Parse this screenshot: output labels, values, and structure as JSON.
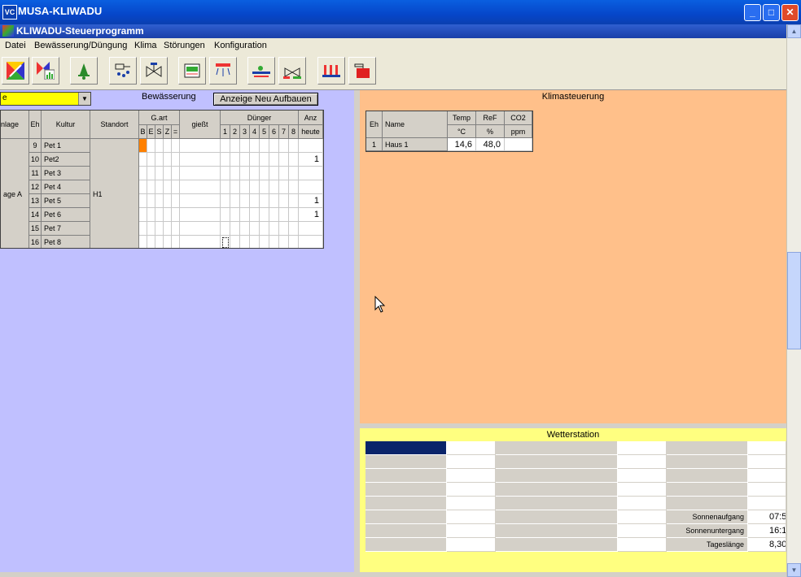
{
  "window": {
    "title": "MUSA-KLIWADU",
    "icon_text": "VC",
    "minimize": "_",
    "maximize": "□",
    "close": "✕"
  },
  "inner_window": {
    "title": "KLIWADU-Steuerprogramm"
  },
  "menu": [
    "Datei",
    "Bewässerung/Düngung",
    "Klima",
    "Störungen",
    "Konfiguration"
  ],
  "toolbar": [
    "wizard-icon",
    "chart-icon",
    "bell-icon",
    "fertilizer-icon",
    "valve-icon",
    "controller-icon",
    "sprinkler-icon",
    "pipeline-icon",
    "valve-station-icon",
    "heater-icon",
    "boiler-icon"
  ],
  "irrigation": {
    "select_value": "e",
    "title": "Bewässerung",
    "rebuild_button": "Anzeige Neu Aufbauen",
    "headers": {
      "anlage": "nlage",
      "eh": "Eh",
      "kultur": "Kultur",
      "standort": "Standort",
      "gart": "G.art",
      "gart_sub": [
        "B",
        "E",
        "S",
        "Z",
        "="
      ],
      "giesst": "gießt",
      "duenger": "Dünger",
      "duenger_sub": [
        "1",
        "2",
        "3",
        "4",
        "5",
        "6",
        "7",
        "8"
      ],
      "anz": "Anz",
      "heute": "heute"
    },
    "anlage_label": "age A",
    "standort_label": "H1",
    "rows": [
      {
        "eh": "9",
        "kultur": "Pet 1",
        "anz": ""
      },
      {
        "eh": "10",
        "kultur": "Pet2",
        "anz": "1"
      },
      {
        "eh": "11",
        "kultur": "Pet 3",
        "anz": ""
      },
      {
        "eh": "12",
        "kultur": "Pet 4",
        "anz": ""
      },
      {
        "eh": "13",
        "kultur": "Pet 5",
        "anz": "1"
      },
      {
        "eh": "14",
        "kultur": "Pet 6",
        "anz": "1"
      },
      {
        "eh": "15",
        "kultur": "Pet 7",
        "anz": ""
      },
      {
        "eh": "16",
        "kultur": "Pet 8",
        "anz": ""
      }
    ]
  },
  "klima": {
    "title": "Klimasteuerung",
    "headers": {
      "eh": "Eh",
      "name": "Name",
      "temp": "Temp",
      "temp_unit": "°C",
      "ref": "ReF",
      "ref_unit": "%",
      "co2": "CO2",
      "co2_unit": "ppm"
    },
    "rows": [
      {
        "eh": "1",
        "name": "Haus 1",
        "temp": "14,6",
        "ref": "48,0",
        "co2": ""
      }
    ]
  },
  "wetter": {
    "title": "Wetterstation",
    "labels": [
      {
        "label": "Sonnenaufgang",
        "value": "07:5"
      },
      {
        "label": "Sonnenuntergang",
        "value": "16:1"
      },
      {
        "label": "Tageslänge",
        "value": "8,30"
      }
    ]
  },
  "colors": {
    "left_panel": "#c0c0ff",
    "klima_panel": "#ffc08a",
    "wetter_panel": "#ffff80",
    "select": "#ffff00",
    "marker": "#ff8000"
  }
}
